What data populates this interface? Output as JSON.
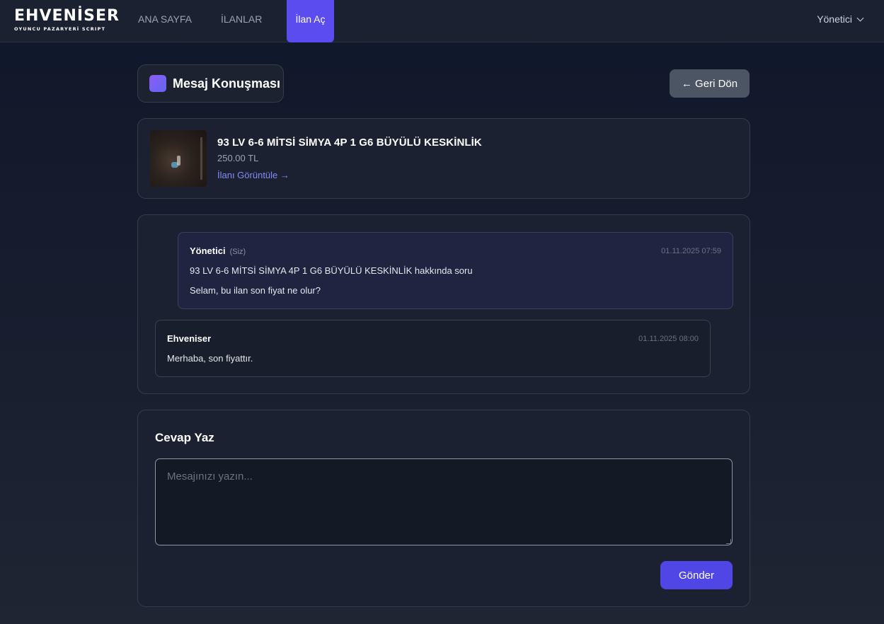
{
  "header": {
    "logo_main": "EHVENİSER",
    "logo_sub": "OYUNCU PAZARYERİ SCRIPT",
    "nav": {
      "home": "ANA SAYFA",
      "listings": "İLANLAR",
      "open_listing": "İlan Aç"
    },
    "user_menu": "Yönetici"
  },
  "page": {
    "title": "Mesaj Konuşması",
    "back_button": "← Geri Dön"
  },
  "listing": {
    "title": "93 LV 6-6 MİTSİ SİMYA 4P 1 G6 BÜYÜLÜ KESKİNLİK",
    "price": "250.00 TL",
    "view_link": "İlanı Görüntüle →"
  },
  "messages": [
    {
      "author": "Yönetici",
      "you_tag": "(Siz)",
      "time": "01.11.2025 07:59",
      "subject": "93 LV 6-6 MİTSİ SİMYA 4P 1 G6 BÜYÜLÜ KESKİNLİK hakkında soru",
      "body": "Selam, bu ilan son fiyat ne olur?"
    },
    {
      "author": "Ehveniser",
      "time": "01.11.2025 08:00",
      "body": "Merhaba, son fiyattır."
    }
  ],
  "reply": {
    "title": "Cevap Yaz",
    "placeholder": "Mesajınızı yazın...",
    "send_button": "Gönder"
  },
  "colors": {
    "accent": "#5b4cf0",
    "send_button": "#5046e5",
    "link": "#818cf8",
    "back_button": "#4b5563"
  }
}
